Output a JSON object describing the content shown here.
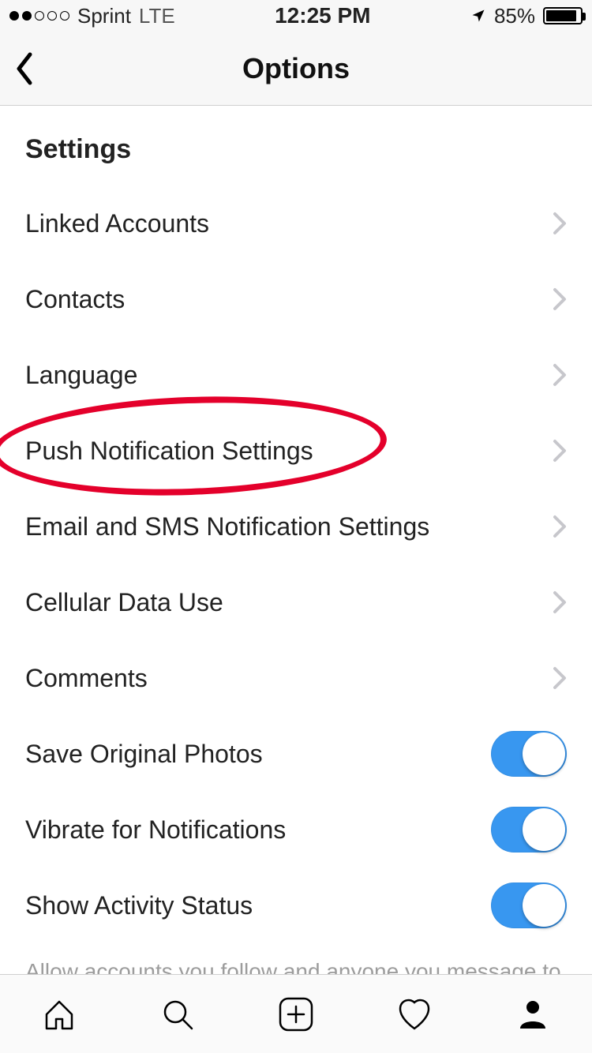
{
  "status": {
    "carrier": "Sprint",
    "network": "LTE",
    "time": "12:25 PM",
    "battery_pct": "85%",
    "battery_fill_pct": 85,
    "signal_filled": 2,
    "signal_total": 5
  },
  "header": {
    "title": "Options"
  },
  "section_title": "Settings",
  "rows": {
    "linked_accounts": "Linked Accounts",
    "contacts": "Contacts",
    "language": "Language",
    "push_notifications": "Push Notification Settings",
    "email_sms": "Email and SMS Notification Settings",
    "cellular": "Cellular Data Use",
    "comments": "Comments",
    "save_photos": "Save Original Photos",
    "vibrate": "Vibrate for Notifications",
    "activity_status": "Show Activity Status"
  },
  "toggles": {
    "save_photos": true,
    "vibrate": true,
    "activity_status": true
  },
  "footnote": "Allow accounts you follow and anyone you message to see",
  "annotation": {
    "highlighted_row": "push_notifications",
    "color": "#e4002b"
  }
}
